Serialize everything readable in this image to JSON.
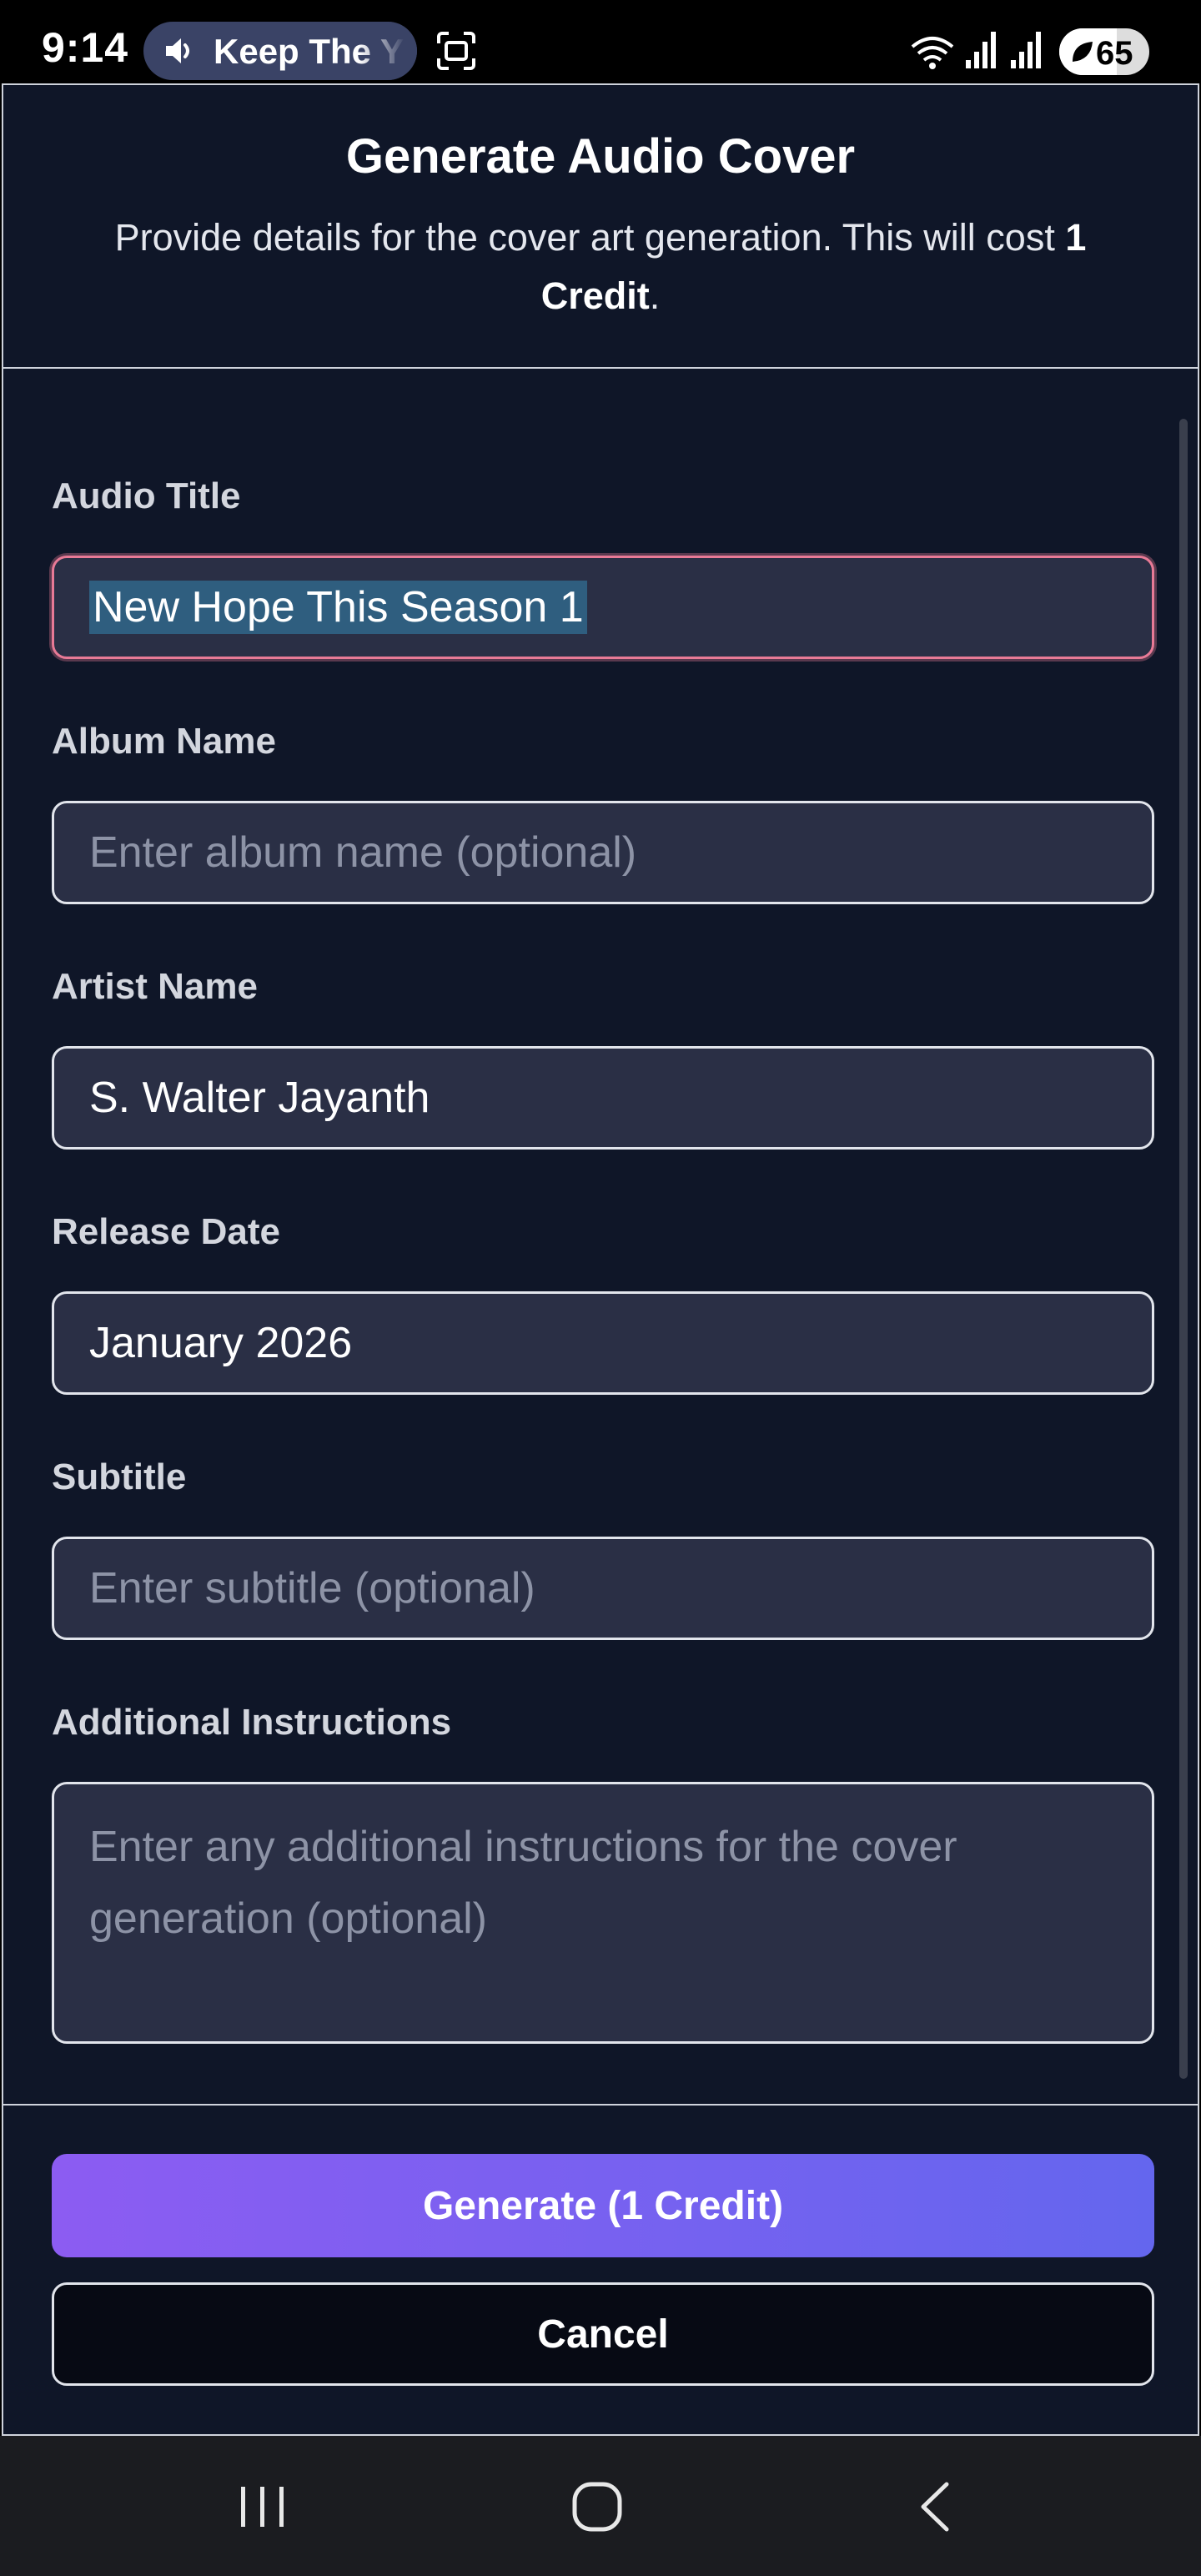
{
  "status_bar": {
    "time": "9:14",
    "media_text": "Keep The Y",
    "battery": "65"
  },
  "dialog": {
    "title": "Generate Audio Cover",
    "description_prefix": "Provide details for the cover art generation. This will cost ",
    "description_bold": "1 Credit",
    "description_suffix": ".",
    "fields": {
      "audio_title": {
        "label": "Audio Title",
        "value": "New Hope This Season 1"
      },
      "album_name": {
        "label": "Album Name",
        "placeholder": "Enter album name (optional)"
      },
      "artist_name": {
        "label": "Artist Name",
        "value": "S. Walter Jayanth"
      },
      "release_date": {
        "label": "Release Date",
        "value": "January 2026"
      },
      "subtitle": {
        "label": "Subtitle",
        "placeholder": "Enter subtitle (optional)"
      },
      "additional_instructions": {
        "label": "Additional Instructions",
        "placeholder": "Enter any additional instructions for the cover generation (optional)"
      }
    },
    "buttons": {
      "generate": "Generate (1 Credit)",
      "cancel": "Cancel"
    }
  },
  "colors": {
    "dialog_bg": "#0f1628",
    "field_bg": "#2a2f45",
    "focus_border": "#e87a96",
    "gradient_start": "#8c5cf2",
    "gradient_end": "#6466ee"
  }
}
